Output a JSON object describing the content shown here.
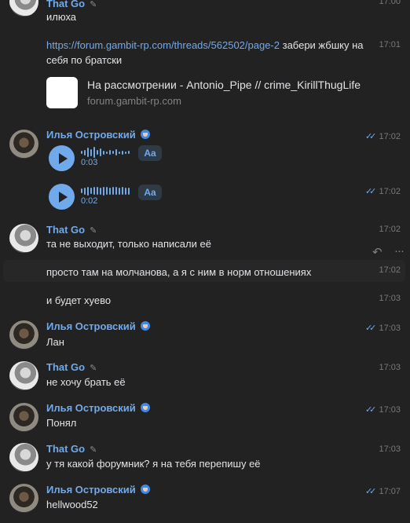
{
  "messages": [
    {
      "sender": "That Go",
      "text": "илюха",
      "time": "17:00"
    },
    {
      "link": "https://forum.gambit-rp.com/threads/562502/page-2",
      "text_after": " забери жбшку на",
      "text_line2": "себя по братски",
      "time": "17:01",
      "snippet": {
        "title": "На рассмотрении - Antonio_Pipe // crime_KirillThugLife",
        "domain": "forum.gambit-rp.com"
      }
    },
    {
      "sender": "Илья Островский",
      "voice_duration": "0:03",
      "transcribe_label": "Aa",
      "time": "17:02"
    },
    {
      "voice_duration": "0:02",
      "transcribe_label": "Aa",
      "time": "17:02"
    },
    {
      "sender": "That Go",
      "text": "та не выходит, только написали её",
      "time": "17:02"
    },
    {
      "text": "просто там на молчанова, а я с ним в норм отношениях",
      "time": "17:02"
    },
    {
      "text": "и будет хуево",
      "time": "17:03"
    },
    {
      "sender": "Илья Островский",
      "text": "Лан",
      "time": "17:03"
    },
    {
      "sender": "That Go",
      "text": "не хочу брать её",
      "time": "17:03"
    },
    {
      "sender": "Илья Островский",
      "text": "Понял",
      "time": "17:03"
    },
    {
      "sender": "That Go",
      "text": "у тя какой форумник? я на тебя перепишу её",
      "time": "17:03"
    },
    {
      "sender": "Илья Островский",
      "text": "hellwood52",
      "time": "17:07"
    }
  ],
  "icons": {
    "read_ticks": "double-check-icon",
    "reply": "reply-icon",
    "more": "more-icon"
  },
  "colors": {
    "accent": "#71aaeb",
    "background": "#222222"
  }
}
